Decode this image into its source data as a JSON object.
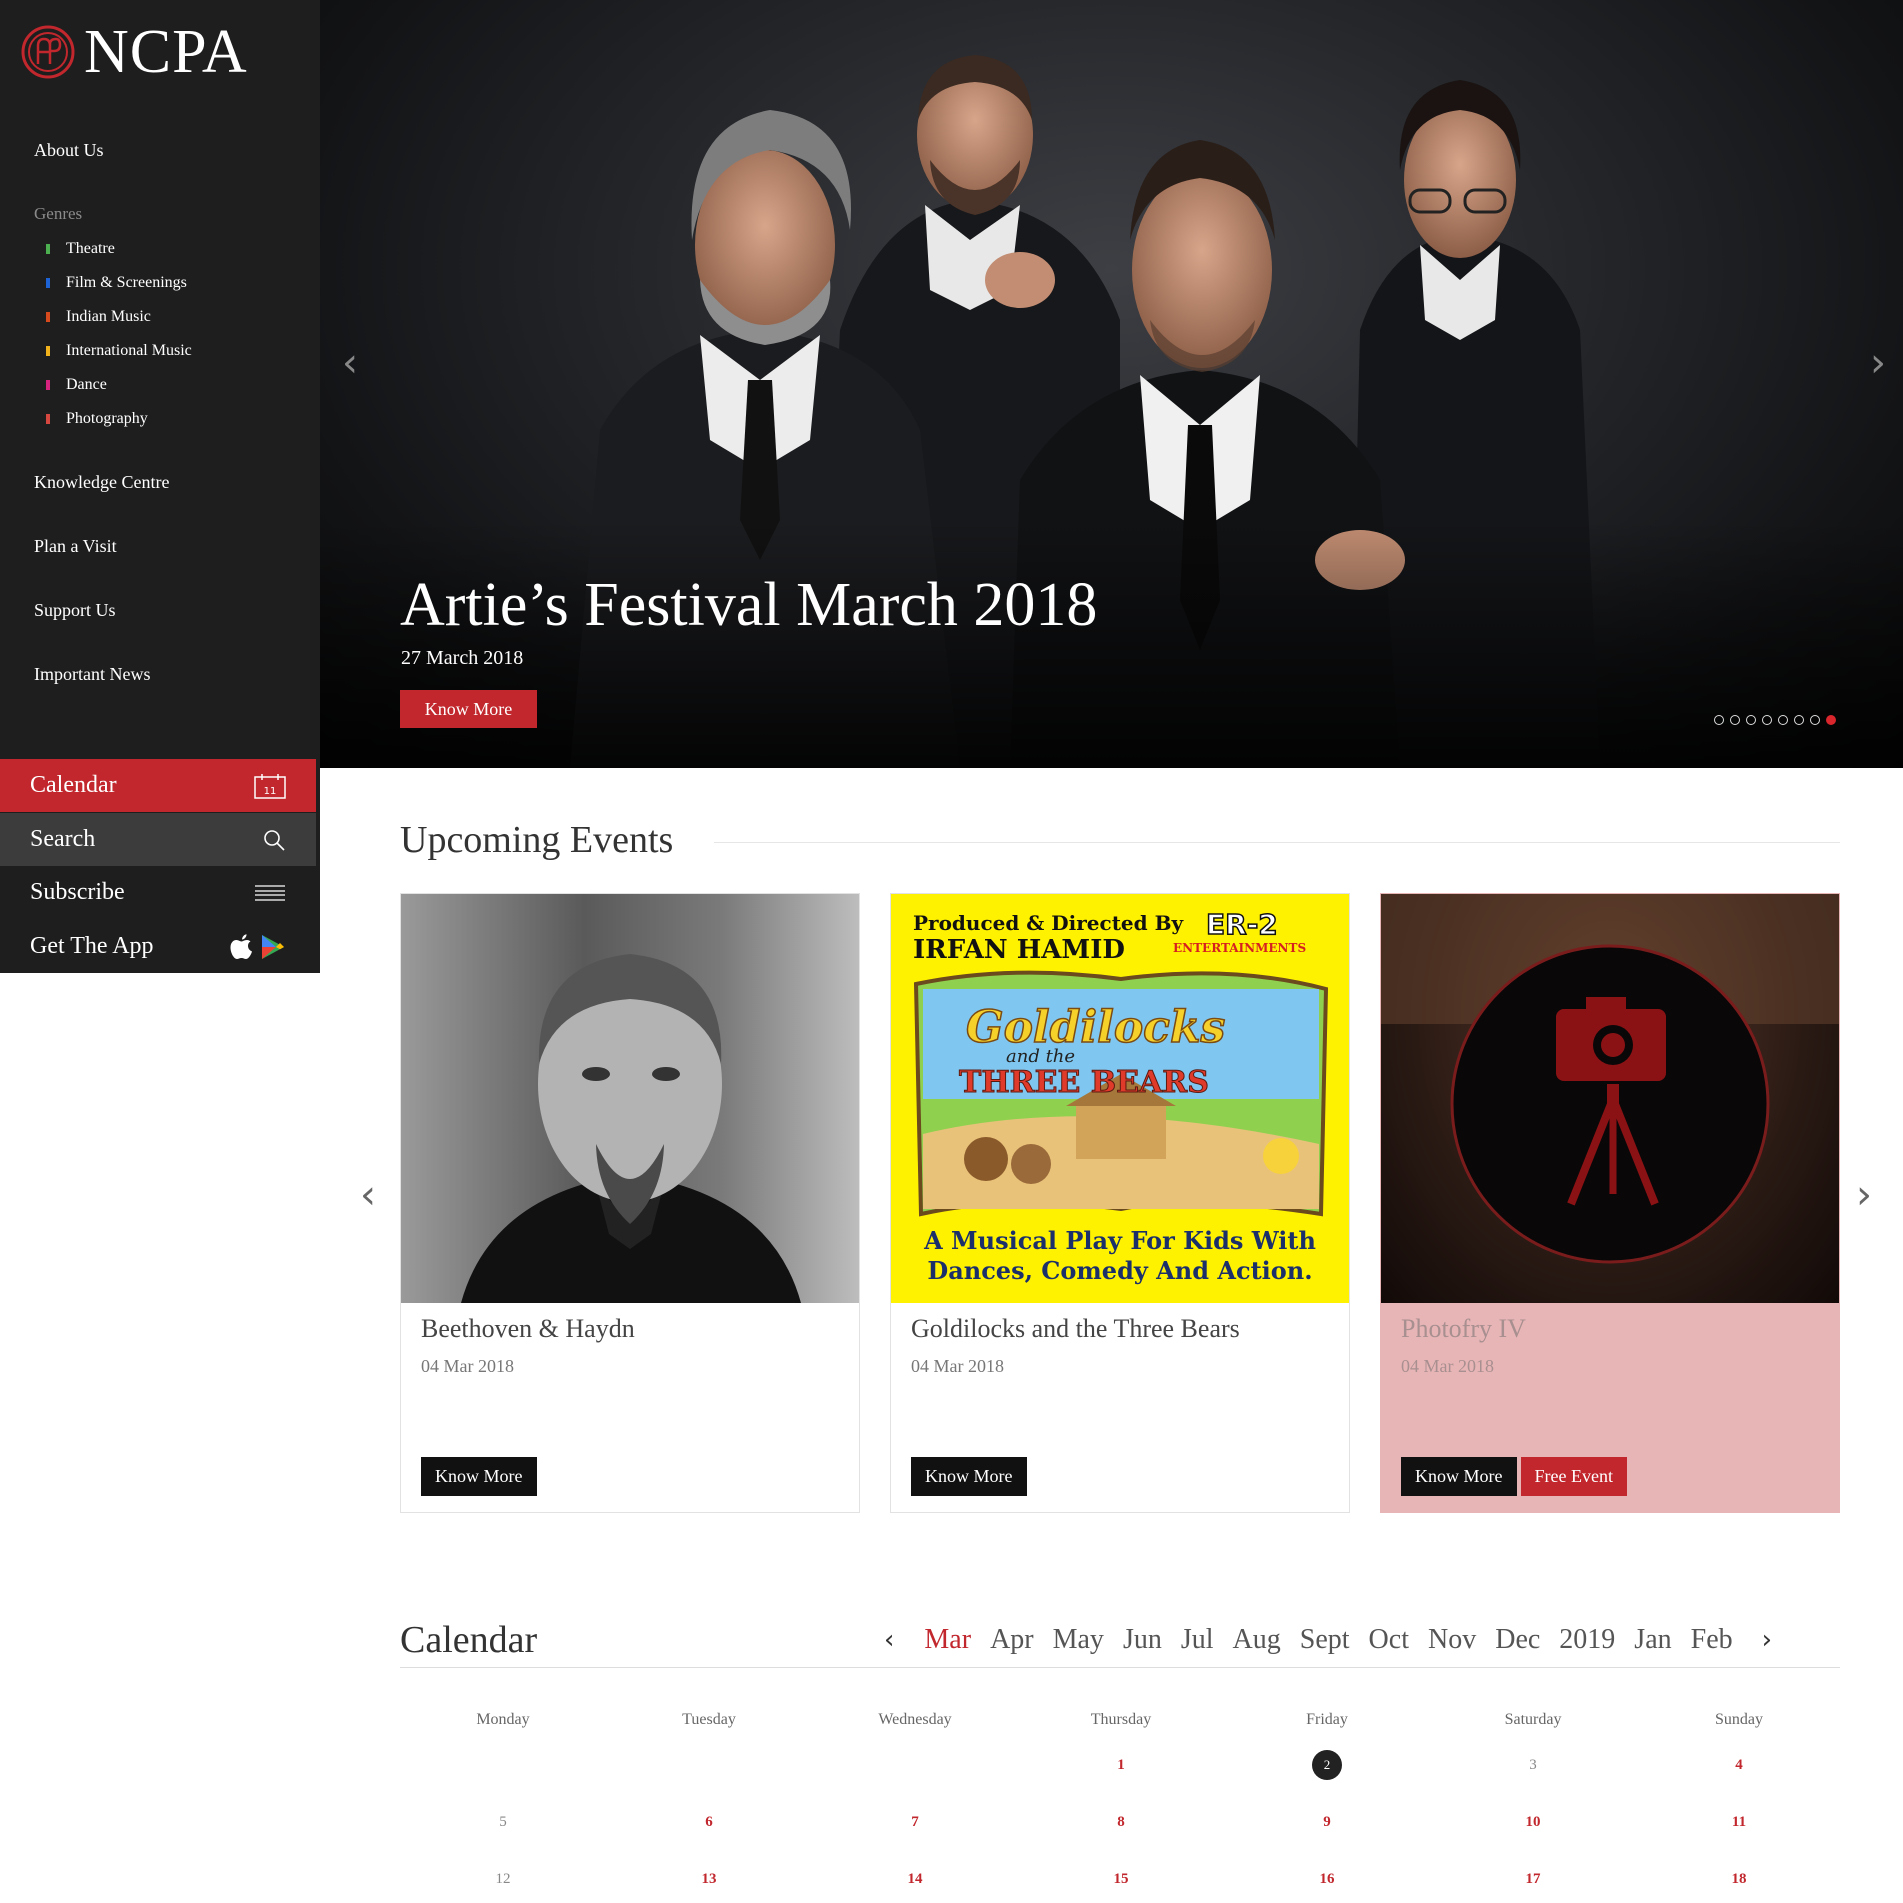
{
  "sidebar": {
    "logo_text": "NCPA",
    "nav": {
      "about": "About Us",
      "genres_title": "Genres",
      "knowledge": "Knowledge Centre",
      "plan": "Plan a Visit",
      "support": "Support Us",
      "news": "Important News"
    },
    "genres": [
      {
        "label": "Theatre",
        "color": "#4caf50"
      },
      {
        "label": "Film & Screenings",
        "color": "#1e63d6"
      },
      {
        "label": "Indian Music",
        "color": "#d64a1e"
      },
      {
        "label": "International Music",
        "color": "#f2b21c"
      },
      {
        "label": "Dance",
        "color": "#d6247e"
      },
      {
        "label": "Photography",
        "color": "#d6473f"
      }
    ],
    "buttons": {
      "calendar": "Calendar",
      "calendar_icon_day": "11",
      "search": "Search",
      "subscribe": "Subscribe",
      "app": "Get The App"
    }
  },
  "hero": {
    "title": "Artie’s Festival March 2018",
    "date": "27 March 2018",
    "button": "Know More",
    "slide_count": 8,
    "active_slide": 8
  },
  "upcoming": {
    "title": "Upcoming Events",
    "events": [
      {
        "title": "Beethoven & Haydn",
        "date": "04 Mar 2018",
        "button": "Know More"
      },
      {
        "title": "Goldilocks and the Three Bears",
        "date": "04 Mar 2018",
        "button": "Know More",
        "poster": {
          "top_left_1": "Produced & Directed By",
          "top_left_2": "IRFAN HAMID",
          "logo_1": "ER-2",
          "logo_2": "ENTERTAINMENTS",
          "title_1": "Goldilocks",
          "title_2": "and the",
          "title_3": "THREE BEARS",
          "tagline_1": "A Musical Play For Kids With",
          "tagline_2": "Dances, Comedy And Action."
        }
      },
      {
        "title": "Photofry IV",
        "date": "04 Mar 2018",
        "button": "Know More",
        "extra_button": "Free Event"
      }
    ]
  },
  "calendar": {
    "title": "Calendar",
    "months": [
      "Mar",
      "Apr",
      "May",
      "Jun",
      "Jul",
      "Aug",
      "Sept",
      "Oct",
      "Nov",
      "Dec",
      "2019",
      "Jan",
      "Feb"
    ],
    "active_month": "Mar",
    "days": [
      "Monday",
      "Tuesday",
      "Wednesday",
      "Thursday",
      "Friday",
      "Saturday",
      "Sunday"
    ],
    "weeks": [
      [
        "",
        "",
        "",
        "1",
        "2",
        "3",
        "4"
      ],
      [
        "5",
        "6",
        "7",
        "8",
        "9",
        "10",
        "11"
      ],
      [
        "12",
        "13",
        "14",
        "15",
        "16",
        "17",
        "18"
      ]
    ],
    "event_days": [
      "1",
      "4",
      "6",
      "7",
      "8",
      "9",
      "10",
      "11",
      "13",
      "14",
      "15",
      "16",
      "17",
      "18"
    ],
    "today": "2"
  }
}
